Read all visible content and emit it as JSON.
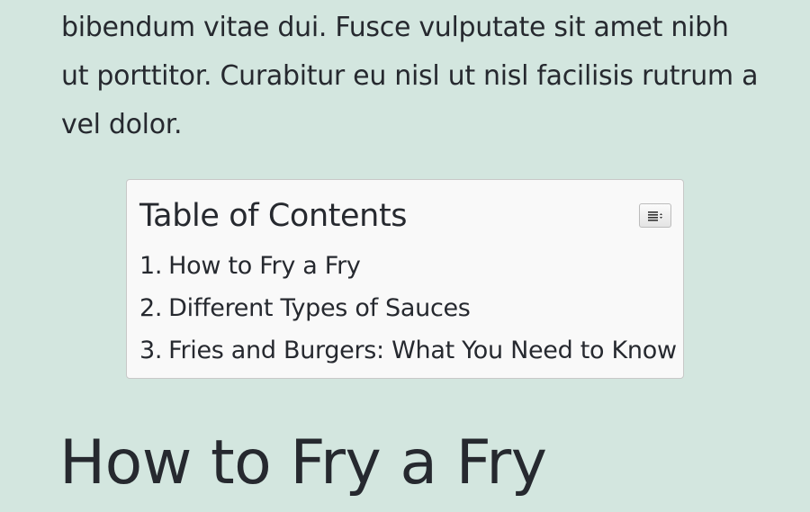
{
  "article": {
    "intro_text": "bibendum vitae dui. Fusce vulputate sit amet nibh ut porttitor. Curabitur eu nisl ut nisl facilisis rutrum a vel dolor."
  },
  "toc": {
    "title": "Table of Contents",
    "toggle_icon": "list-toggle-icon",
    "items": [
      {
        "number": "1.",
        "label": "How to Fry a Fry"
      },
      {
        "number": "2.",
        "label": "Different Types of Sauces"
      },
      {
        "number": "3.",
        "label": "Fries and Burgers: What You Need to Know"
      }
    ]
  },
  "section": {
    "heading": "How to Fry a Fry"
  },
  "colors": {
    "page_background": "#d3e6df",
    "toc_background": "#f9f9f9",
    "text": "#26292f"
  }
}
